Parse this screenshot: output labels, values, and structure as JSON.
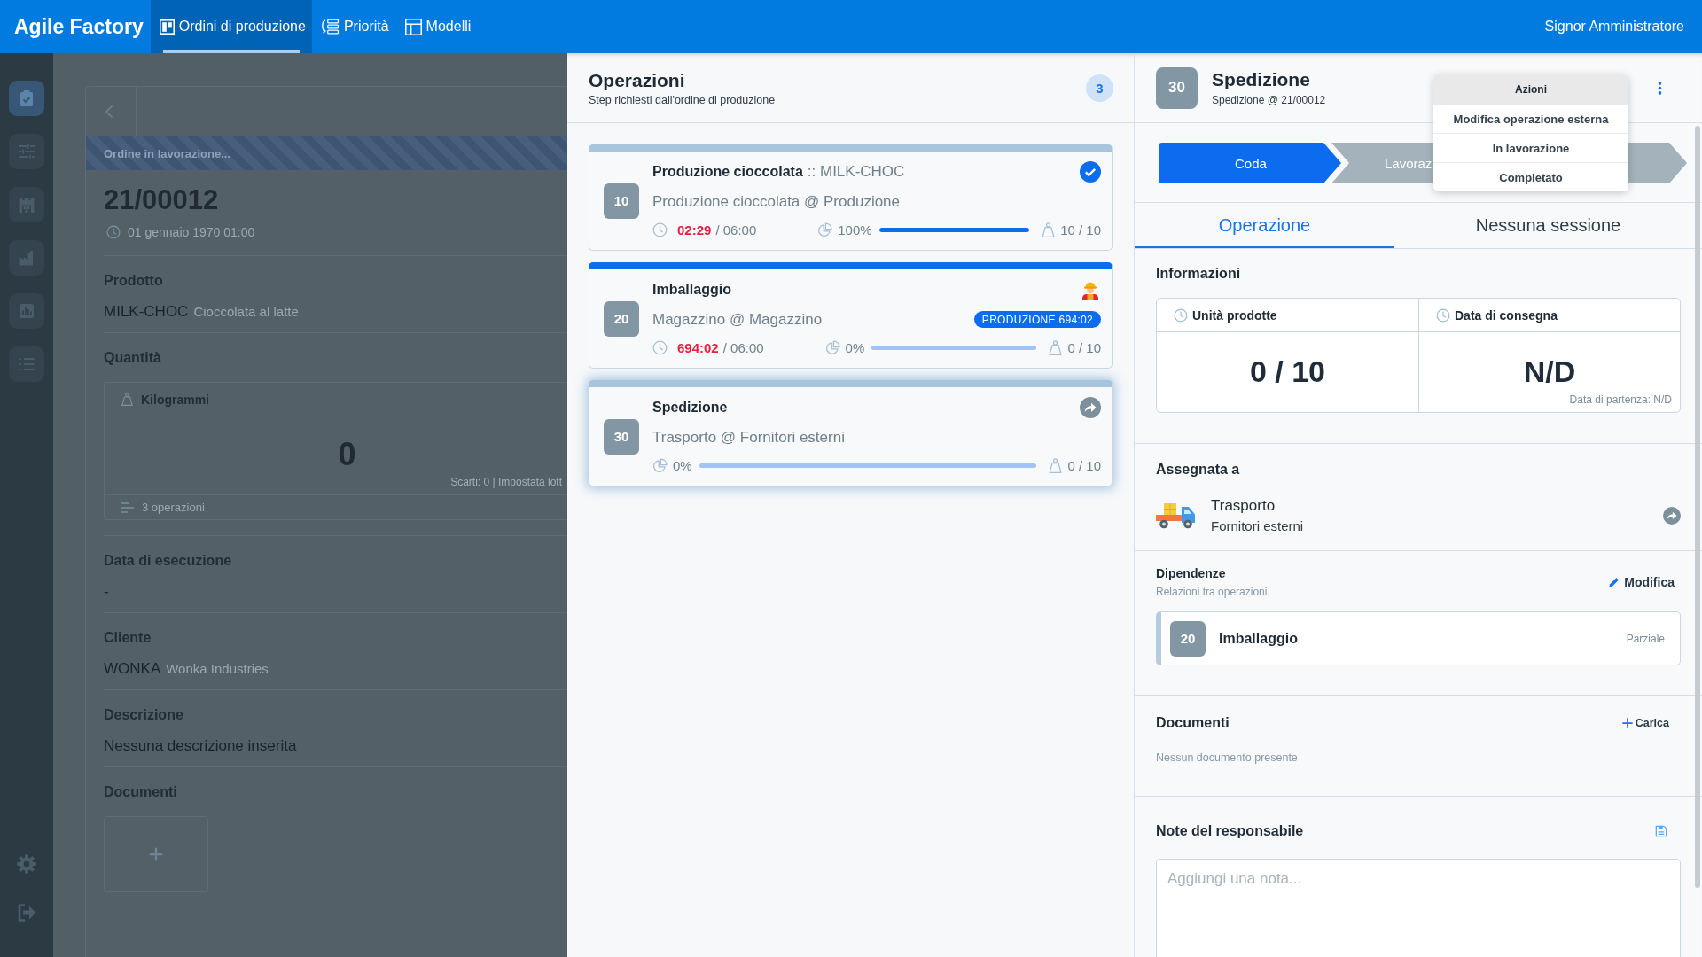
{
  "topbar": {
    "logo": "Agile Factory",
    "tabs": [
      {
        "label": "Ordini di produzione",
        "selected": true
      },
      {
        "label": "Priorità",
        "selected": false
      },
      {
        "label": "Modelli",
        "selected": false
      }
    ],
    "user": "Signor Amministratore"
  },
  "sidebar": {
    "items": [
      {
        "selected": true
      },
      {
        "selected": false
      },
      {
        "selected": false
      },
      {
        "selected": false
      },
      {
        "selected": false
      },
      {
        "selected": false
      }
    ]
  },
  "order": {
    "status": "Ordine in lavorazione...",
    "code": "21/00012",
    "date": "01 gennaio 1970 01:00",
    "fields": [
      {
        "kind": "text",
        "label": "Prodotto",
        "value": "MILK-CHOC",
        "note": "Cioccolata al latte"
      },
      {
        "kind": "quantity",
        "label": "Quantità",
        "unit": "Kilogrammi",
        "value": "0",
        "info": "Scarti: 0 | Impostata lott",
        "footer": "3 operazioni"
      },
      {
        "kind": "text",
        "label": "Data di esecuzione",
        "value": "-"
      },
      {
        "kind": "text",
        "label": "Cliente",
        "value": "WONKA",
        "note": "Wonka Industries"
      },
      {
        "kind": "text",
        "label": "Descrizione",
        "value": "Nessuna descrizione inserita"
      },
      {
        "kind": "upload",
        "label": "Documenti"
      }
    ]
  },
  "operations": {
    "title": "Operazioni",
    "subtitle": "Step richiesti dall'ordine di produzione",
    "count": "3",
    "cards": [
      {
        "kind": "completed",
        "number": "10",
        "title": "Produzione cioccolata",
        "code": ":: MILK-CHOC",
        "location": "Produzione cioccolata @ Produzione",
        "selected": false,
        "elapsed": "02:29",
        "planned": "/ 06:00",
        "percent": "100%",
        "level": 1,
        "quantity": "10 / 10"
      },
      {
        "kind": "active",
        "number": "20",
        "title": "Imballaggio",
        "location": "Magazzino @ Magazzino",
        "badge": "PRODUZIONE 694:02",
        "selected": false,
        "elapsed": "694:02",
        "planned": "/ 06:00",
        "percent": "0%",
        "level": 0,
        "quantity": "0 / 10"
      },
      {
        "kind": "external",
        "number": "30",
        "title": "Spedizione",
        "location": "Trasporto @ Fornitori esterni",
        "selected": true,
        "percent": "0%",
        "level": 0,
        "quantity": "0 / 10"
      }
    ]
  },
  "detail": {
    "number": "30",
    "title": "Spedizione",
    "subtitle": "Spedizione @ 21/00012",
    "menu": {
      "title": "Azioni",
      "items": [
        "Modifica operazione esterna",
        "In lavorazione",
        "Completato"
      ]
    },
    "steps": [
      {
        "label": "Coda",
        "selected": true
      },
      {
        "label": "Lavoraz",
        "selected": false
      },
      {
        "selected": false
      }
    ],
    "tabs": [
      {
        "label": "Operazione",
        "selected": true
      },
      {
        "label": "Nessuna sessione",
        "selected": false
      }
    ],
    "info": {
      "title": "Informazioni",
      "cells": [
        {
          "label": "Unità prodotte",
          "value": "0 / 10"
        },
        {
          "label": "Data di consegna",
          "value": "N/D",
          "note": "Data di partenza: N/D"
        }
      ]
    },
    "assigned": {
      "title": "Assegnata a",
      "name": "Trasporto",
      "group": "Fornitori esterni"
    },
    "dependencies": {
      "title": "Dipendenze",
      "subtitle": "Relazioni tra operazioni",
      "action": "Modifica",
      "items": [
        {
          "number": "20",
          "name": "Imballaggio",
          "type": "Parziale"
        }
      ]
    },
    "documents": {
      "title": "Documenti",
      "action": "Carica",
      "empty": "Nessun documento presente"
    },
    "notes": {
      "title": "Note del responsabile",
      "placeholder": "Aggiungi una nota..."
    }
  }
}
